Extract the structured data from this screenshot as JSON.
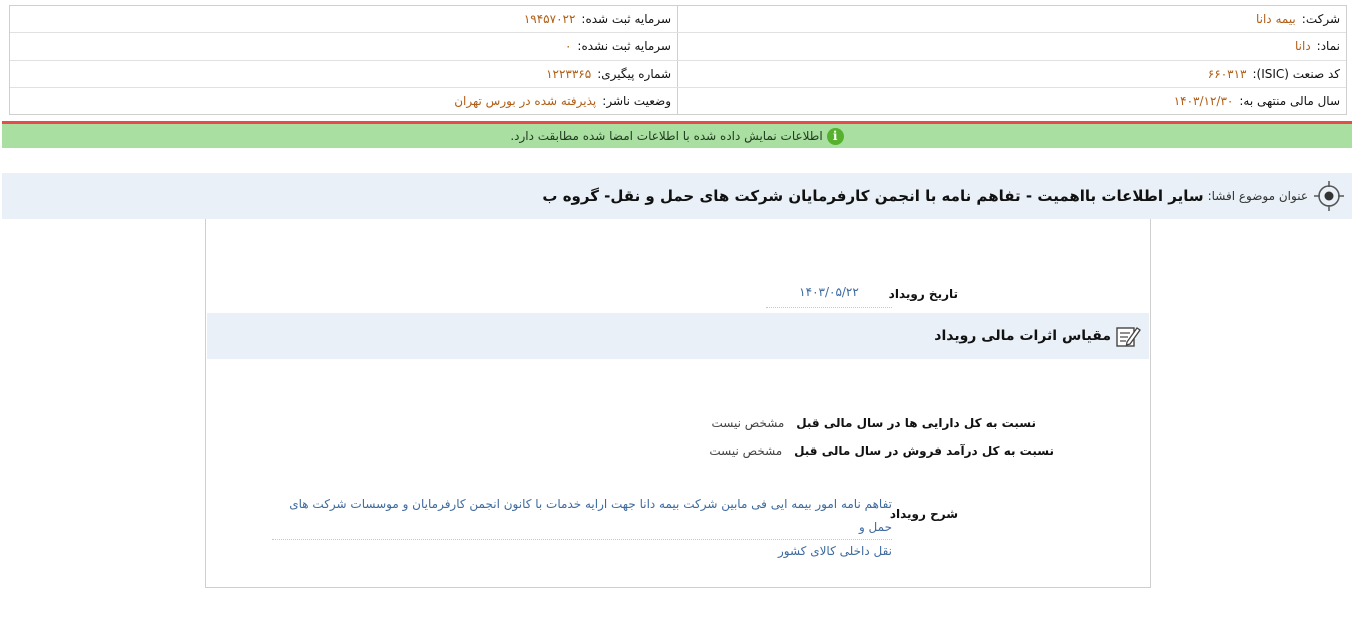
{
  "company": {
    "name_label": "شرکت:",
    "name_value": "بیمه دانا",
    "symbol_label": "نماد:",
    "symbol_value": "دانا",
    "isic_label": "کد صنعت (ISIC):",
    "isic_value": "۶۶۰۳۱۳",
    "fiscal_label": "سال مالی منتهی به:",
    "fiscal_value": "۱۴۰۳/۱۲/۳۰",
    "reg_capital_label": "سرمایه ثبت شده:",
    "reg_capital_value": "۱۹۴۵۷۰۲۲",
    "unreg_capital_label": "سرمایه ثبت نشده:",
    "unreg_capital_value": "۰",
    "tracking_label": "شماره پیگیری:",
    "tracking_value": "۱۲۲۳۳۶۵",
    "status_label": "وضعیت ناشر:",
    "status_value": "پذیرفته شده در بورس تهران"
  },
  "notice": {
    "text": "اطلاعات نمایش داده شده با اطلاعات امضا شده مطابقت دارد.",
    "icon": "info-icon"
  },
  "disclosure": {
    "subject_label": "عنوان موضوع افشا:",
    "subject_value": "سایر اطلاعات بااهمیت - تفاهم نامه با انجمن کارفرمایان شرکت های حمل و نقل- گروه ب"
  },
  "event": {
    "date_label": "تاریخ رویداد",
    "date_value": "۱۴۰۳/۰۵/۲۲",
    "section_title": "مقیاس اثرات مالی رویداد",
    "assets_label": "نسبت به کل دارایی ها در سال مالی قبل",
    "assets_value": "مشخص نیست",
    "revenue_label": "نسبت به کل درآمد فروش در سال مالی قبل",
    "revenue_value": "مشخص نیست",
    "desc_label": "شرح رویداد",
    "desc_line1": "تفاهم نامه امور بیمه ایی فی مابین شرکت بیمه دانا جهت ارایه خدمات با کانون انجمن کارفرمایان و موسسات شرکت های حمل و",
    "desc_line2": "نقل داخلی کالای کشور"
  }
}
